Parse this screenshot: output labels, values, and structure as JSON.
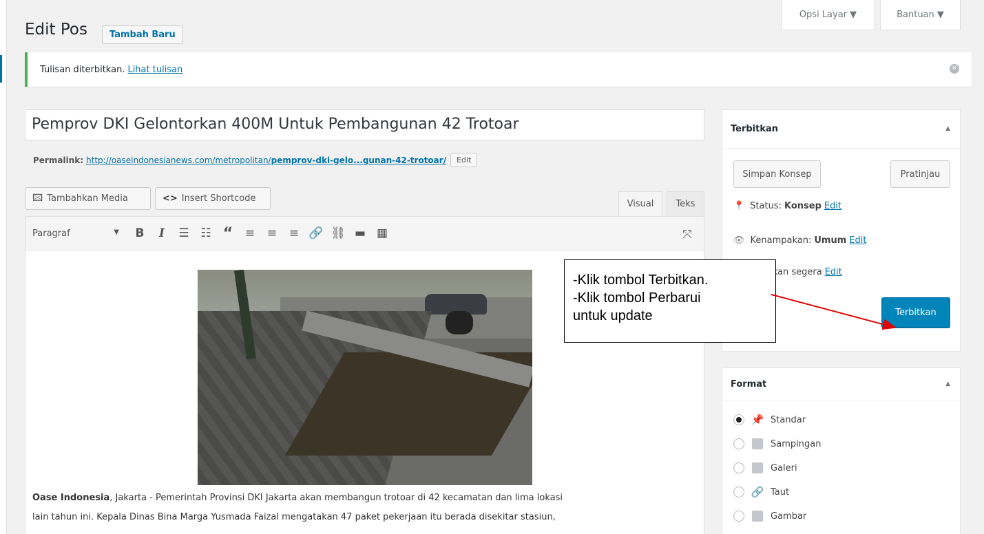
{
  "page": {
    "title": "Edit Pos",
    "add_new": "Tambah Baru"
  },
  "top_tabs": {
    "screen_options": "Opsi Layar ▼",
    "help": "Bantuan ▼"
  },
  "notice": {
    "text": "Tulisan diterbitkan.",
    "link": "Lihat tulisan"
  },
  "post": {
    "title": "Pemprov DKI Gelontorkan 400M Untuk Pembangunan 42 Trotoar",
    "permalink_label": "Permalink:",
    "permalink_base": "http://oaseindonesianews.com/metropolitan/",
    "permalink_slug": "pemprov-dki-gelo...gunan-42-trotoar/",
    "permalink_edit": "Edit"
  },
  "editor": {
    "add_media": "Tambahkan Media",
    "insert_shortcode": "Insert Shortcode",
    "tab_visual": "Visual",
    "tab_text": "Teks",
    "format_select": "Paragraf",
    "article_bold": "Oase Indonesia",
    "article_line1": ", Jakarta - Pemerintah Provinsi DKI Jakarta akan membangun trotoar di 42 kecamatan dan lima lokasi",
    "article_line2": "lain tahun ini. Kepala Dinas Bina Marga Yusmada Faizal mengatakan 47 paket pekerjaan itu berada disekitar stasiun,"
  },
  "publish_box": {
    "title": "Terbitkan",
    "save_draft": "Simpan Konsep",
    "preview": "Pratinjau",
    "status_label": "Status:",
    "status_value": "Konsep",
    "visibility_label": "Kenampakan:",
    "visibility_value": "Umum",
    "schedule_text": "itkan segera",
    "edit": "Edit",
    "publish_button": "Terbitkan"
  },
  "format_box": {
    "title": "Format",
    "options": [
      "Standar",
      "Sampingan",
      "Galeri",
      "Taut",
      "Gambar"
    ],
    "selected": "Standar"
  },
  "callout": {
    "line1": "-Klik tombol Terbitkan.",
    "line2": "-Klik tombol Perbarui",
    "line3": "untuk update"
  },
  "colors": {
    "accent": "#0085ba",
    "success": "#46b450",
    "arrow": "#e00000"
  }
}
